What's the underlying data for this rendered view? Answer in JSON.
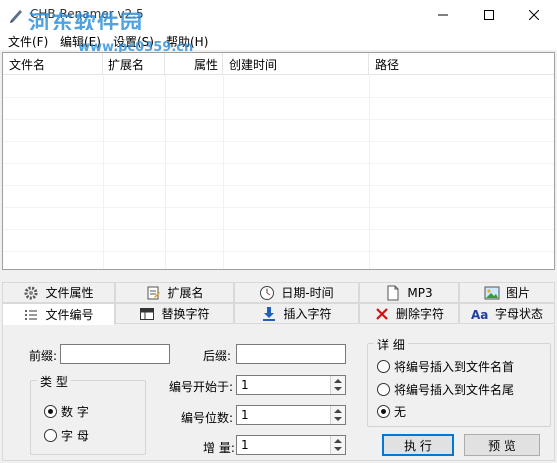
{
  "window": {
    "title": "CHB Renamer v2.5",
    "watermark": "河东软件园",
    "watermark_url": "www.pc0359.cn"
  },
  "menu": [
    "文件(F)",
    "编辑(E)",
    "设置(S)",
    "帮助(H)"
  ],
  "list": {
    "columns": [
      "文件名",
      "扩展名",
      "属性",
      "创建时间",
      "路径"
    ]
  },
  "tabs": {
    "row1": [
      "文件属性",
      "扩展名",
      "日期-时间",
      "MP3",
      "图片"
    ],
    "row2": [
      "文件编号",
      "替换字符",
      "插入字符",
      "删除字符",
      "字母状态"
    ],
    "active": "文件编号"
  },
  "panel": {
    "prefix_label": "前缀:",
    "prefix_value": "",
    "suffix_label": "后缀:",
    "suffix_value": "",
    "type_group": "类 型",
    "type_options": [
      "数 字",
      "字 母"
    ],
    "type_selected": "数 字",
    "start_label": "编号开始于:",
    "start_value": "1",
    "digits_label": "编号位数:",
    "digits_value": "1",
    "increment_label": "增 量:",
    "increment_value": "1",
    "detail_group": "详 细",
    "detail_options": [
      "将编号插入到文件名首",
      "将编号插入到文件名尾",
      "无"
    ],
    "detail_selected": "无",
    "execute_label": "执 行",
    "preview_label": "预 览"
  }
}
